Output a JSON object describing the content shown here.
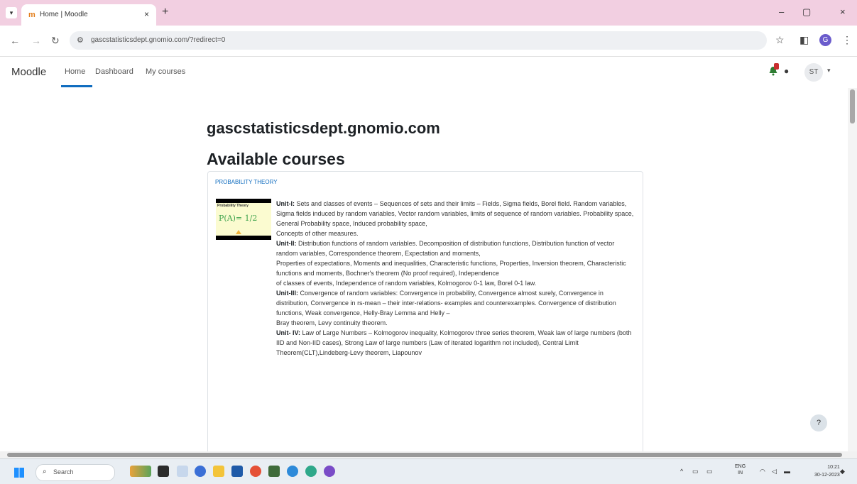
{
  "browser": {
    "tab_list_icon": "chevron-down-icon",
    "tab_title": "Home | Moodle",
    "tab_close": "×",
    "new_tab": "+",
    "window_controls": {
      "minimize": "–",
      "restore": "▢",
      "close": "×"
    },
    "nav": {
      "back": "←",
      "forward": "→",
      "reload": "↻"
    },
    "url": "gascstatisticsdept.gnomio.com/?redirect=0",
    "star": "☆",
    "sidepanel": "◧",
    "profile_initial": "G",
    "menu": "⋮"
  },
  "moodle_nav": {
    "brand": "Moodle",
    "links": [
      "Home",
      "Dashboard",
      "My courses"
    ],
    "active": "Home",
    "user_initials": "ST",
    "caret": "▾"
  },
  "page": {
    "site_title": "gascstatisticsdept.gnomio.com",
    "section_title": "Available courses",
    "course": {
      "name": "PROBABILITY THEORY",
      "thumbnail": {
        "caption": "Probability Theory",
        "equation": "P(A)= 1/2"
      },
      "summary": [
        {
          "bold": "Unit-I:",
          "text": " Sets and classes of events – Sequences of sets and their limits – Fields, Sigma fields, Borel field. Random variables, Sigma fields induced by random variables, Vector random variables, limits of sequence of random variables. Probability space, General Probability space, Induced probability space,"
        },
        {
          "bold": "",
          "text": "Concepts of other measures."
        },
        {
          "bold": "Unit-II:",
          "text": " Distribution functions of random variables. Decomposition of distribution functions, Distribution function of vector random variables, Correspondence theorem, Expectation and moments,"
        },
        {
          "bold": "",
          "text": "Properties of expectations, Moments and inequalities, Characteristic functions, Properties, Inversion theorem, Characteristic functions and moments, Bochner's theorem (No proof required), Independence"
        },
        {
          "bold": "",
          "text": "of classes of events, Independence of random variables, Kolmogorov 0-1 law, Borel 0-1 law."
        },
        {
          "bold": "Unit-III:",
          "text": " Convergence of random variables: Convergence in probability, Convergence almost surely, Convergence in distribution, Convergence in rs-mean – their inter-relations- examples and counterexamples. Convergence of distribution functions, Weak convergence, Helly-Bray Lemma and Helly –"
        },
        {
          "bold": "",
          "text": "Bray theorem, Levy continuity theorem."
        },
        {
          "bold": "Unit- IV:",
          "text": " Law of Large Numbers – Kolmogorov inequality, Kolmogorov three series theorem, Weak law of large numbers (both IID and Non-IID cases), Strong Law of large numbers (Law of iterated logarithm not included), Central Limit Theorem(CLT),Lindeberg-Levy theorem, Liapounov"
        }
      ]
    },
    "help": "?"
  },
  "taskbar": {
    "search_placeholder": "Search",
    "language": [
      "ENG",
      "IN"
    ],
    "time": "10:21",
    "date": "30-12-2023"
  },
  "colors": {
    "tabbar": "#f2cfe1",
    "link": "#0f6cbf",
    "frame": "#e4ecd8"
  }
}
